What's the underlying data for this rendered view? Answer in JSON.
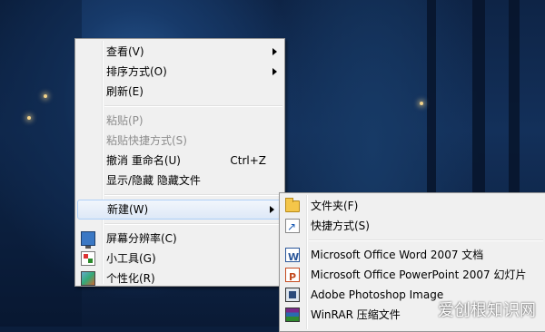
{
  "context_menu": {
    "items": [
      {
        "label": "查看(V)"
      },
      {
        "label": "排序方式(O)"
      },
      {
        "label": "刷新(E)"
      },
      {
        "label": "粘贴(P)"
      },
      {
        "label": "粘贴快捷方式(S)"
      },
      {
        "label": "撤消 重命名(U)",
        "shortcut": "Ctrl+Z"
      },
      {
        "label": "显示/隐藏 隐藏文件"
      },
      {
        "label": "新建(W)"
      },
      {
        "label": "屏幕分辨率(C)"
      },
      {
        "label": "小工具(G)"
      },
      {
        "label": "个性化(R)"
      }
    ]
  },
  "new_submenu": {
    "items": [
      {
        "label": "文件夹(F)"
      },
      {
        "label": "快捷方式(S)"
      },
      {
        "label": "Microsoft Office Word 2007 文档"
      },
      {
        "label": "Microsoft Office PowerPoint 2007 幻灯片"
      },
      {
        "label": "Adobe Photoshop Image"
      },
      {
        "label": "WinRAR 压缩文件"
      }
    ]
  },
  "watermark": {
    "text": "爱创根知识网"
  }
}
